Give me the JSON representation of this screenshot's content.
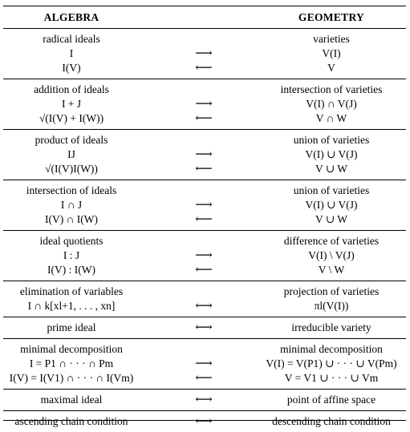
{
  "header": {
    "left": "ALGEBRA",
    "right": "GEOMETRY"
  },
  "sections": [
    {
      "rows": [
        {
          "left": "radical ideals",
          "mid": "",
          "right": "varieties"
        },
        {
          "left": "I",
          "mid": "⟶",
          "right": "V(I)"
        },
        {
          "left": "I(V)",
          "mid": "⟵",
          "right": "V"
        }
      ]
    },
    {
      "rows": [
        {
          "left": "addition of ideals",
          "mid": "",
          "right": "intersection of varieties"
        },
        {
          "left": "I + J",
          "mid": "⟶",
          "right": "V(I) ∩ V(J)"
        },
        {
          "left": "√(I(V) + I(W))",
          "mid": "⟵",
          "right": "V ∩ W"
        }
      ]
    },
    {
      "rows": [
        {
          "left": "product of ideals",
          "mid": "",
          "right": "union of varieties"
        },
        {
          "left": "IJ",
          "mid": "⟶",
          "right": "V(I) ∪ V(J)"
        },
        {
          "left": "√(I(V)I(W))",
          "mid": "⟵",
          "right": "V ∪ W"
        }
      ]
    },
    {
      "rows": [
        {
          "left": "intersection of ideals",
          "mid": "",
          "right": "union of varieties"
        },
        {
          "left": "I ∩ J",
          "mid": "⟶",
          "right": "V(I) ∪ V(J)"
        },
        {
          "left": "I(V) ∩ I(W)",
          "mid": "⟵",
          "right": "V ∪ W"
        }
      ]
    },
    {
      "rows": [
        {
          "left": "ideal quotients",
          "mid": "",
          "right": "difference of varieties"
        },
        {
          "left": "I : J",
          "mid": "⟶",
          "right": "V(I) \\ V(J)"
        },
        {
          "left": "I(V) : I(W)",
          "mid": "⟵",
          "right": "V \\ W"
        }
      ]
    },
    {
      "rows": [
        {
          "left": "elimination of variables",
          "mid": "",
          "right": "projection of varieties"
        },
        {
          "left": "I ∩ k[xl+1, . . . , xn]",
          "mid": "⟷",
          "right": "πl(V(I))"
        }
      ]
    },
    {
      "rows": [
        {
          "left": "prime ideal",
          "mid": "⟷",
          "right": "irreducible variety"
        }
      ]
    },
    {
      "rows": [
        {
          "left": "minimal decomposition",
          "mid": "",
          "right": "minimal decomposition"
        },
        {
          "left": "I = P1 ∩ · · · ∩ Pm",
          "mid": "⟶",
          "right": "V(I) = V(P1) ∪ · · · ∪ V(Pm)"
        },
        {
          "left": "I(V) = I(V1) ∩ · · · ∩ I(Vm)",
          "mid": "⟵",
          "right": "V = V1 ∪ · · · ∪ Vm"
        }
      ]
    },
    {
      "rows": [
        {
          "left": "maximal ideal",
          "mid": "⟷",
          "right": "point of affine space"
        }
      ]
    },
    {
      "rows": [
        {
          "left": "ascending chain condition",
          "mid": "⟷",
          "right": "descending chain condition"
        }
      ]
    }
  ]
}
